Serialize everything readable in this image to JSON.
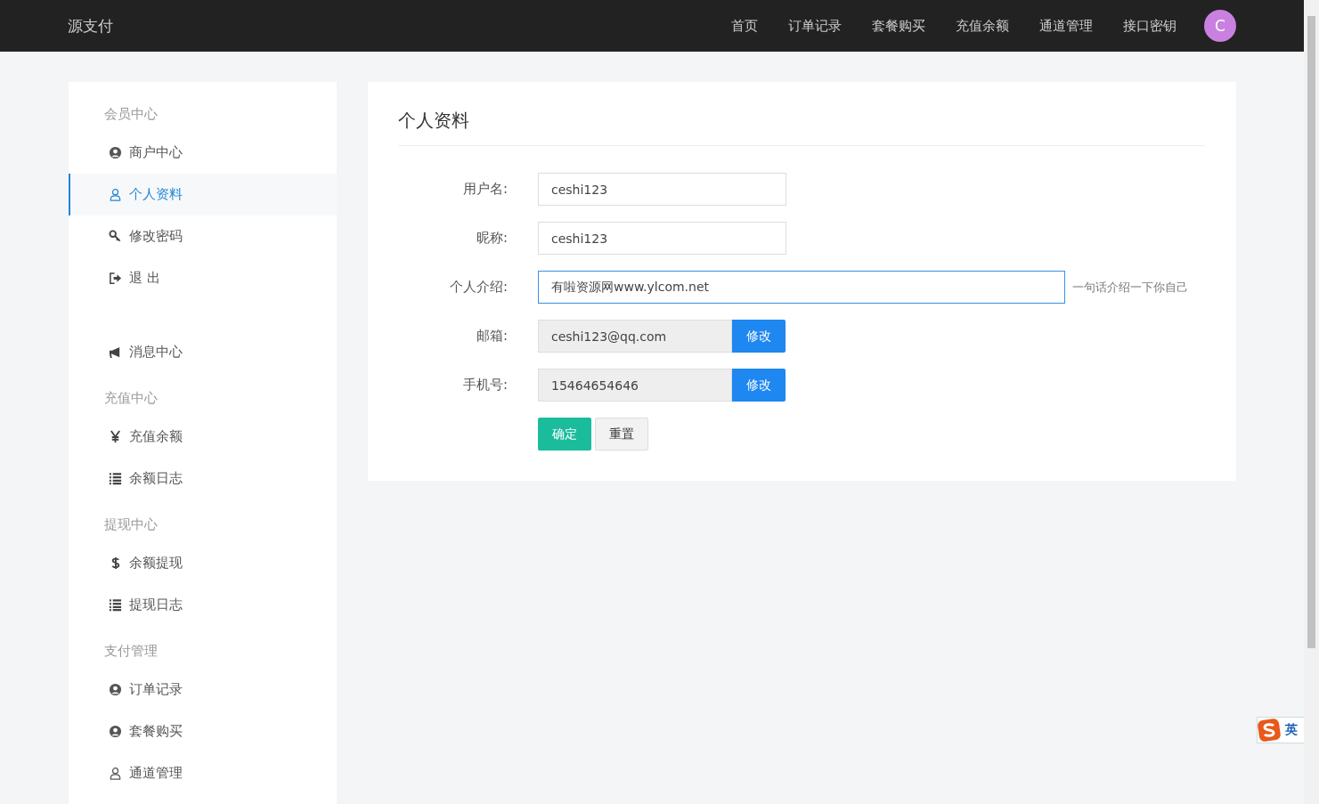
{
  "header": {
    "brand": "源支付",
    "nav": [
      {
        "label": "首页"
      },
      {
        "label": "订单记录"
      },
      {
        "label": "套餐购买"
      },
      {
        "label": "充值余额"
      },
      {
        "label": "通道管理"
      },
      {
        "label": "接口密钥"
      }
    ],
    "avatar": "C"
  },
  "sidebar": {
    "sections": [
      {
        "title": "会员中心",
        "items": [
          {
            "label": "商户中心",
            "selected": false
          },
          {
            "label": "个人资料",
            "selected": true
          },
          {
            "label": "修改密码",
            "selected": false
          },
          {
            "label": "退 出",
            "selected": false
          }
        ]
      },
      {
        "items": [
          {
            "label": "消息中心",
            "selected": false
          }
        ]
      },
      {
        "title": "充值中心",
        "items": [
          {
            "label": "充值余额",
            "selected": false
          },
          {
            "label": "余额日志",
            "selected": false
          }
        ]
      },
      {
        "title": "提现中心",
        "items": [
          {
            "label": "余额提现",
            "selected": false
          },
          {
            "label": "提现日志",
            "selected": false
          }
        ]
      },
      {
        "title": "支付管理",
        "items": [
          {
            "label": "订单记录",
            "selected": false
          },
          {
            "label": "套餐购买",
            "selected": false
          },
          {
            "label": "通道管理",
            "selected": false
          }
        ]
      }
    ]
  },
  "panel": {
    "title": "个人资料",
    "fields": [
      {
        "kind": "text",
        "label": "用户名:",
        "value": "ceshi123",
        "focused": false
      },
      {
        "kind": "text",
        "label": "昵称:",
        "value": "ceshi123",
        "focused": false
      },
      {
        "kind": "wide",
        "label": "个人介绍:",
        "value": "有啦资源网www.ylcom.net",
        "focused": true,
        "hint": "一句话介绍一下你自己"
      },
      {
        "kind": "action",
        "label": "邮箱:",
        "value": "ceshi123@qq.com",
        "focused": false,
        "button": "修改"
      },
      {
        "kind": "action",
        "label": "手机号:",
        "value": "15464654646",
        "focused": false,
        "button": "修改"
      }
    ],
    "submit": "确定",
    "reset": "重置"
  },
  "ime": {
    "mode": "英"
  }
}
